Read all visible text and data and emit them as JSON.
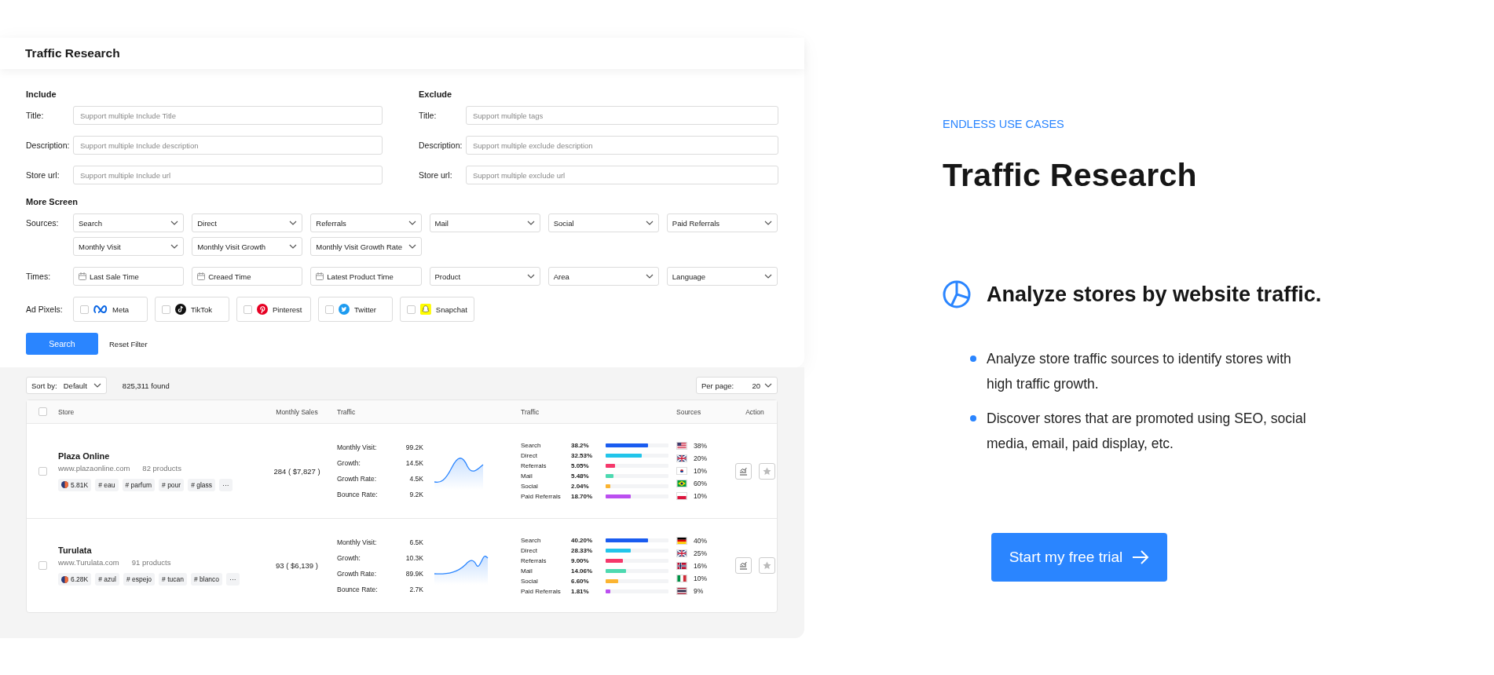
{
  "panel": {
    "title": "Traffic Research"
  },
  "include": {
    "heading": "Include",
    "fields": [
      {
        "label": "Title:",
        "placeholder": "Support multiple Include Title"
      },
      {
        "label": "Description:",
        "placeholder": "Support multiple Include description"
      },
      {
        "label": "Store url:",
        "placeholder": "Support multiple Include url"
      }
    ]
  },
  "exclude": {
    "heading": "Exclude",
    "fields": [
      {
        "label": "Title:",
        "placeholder": "Support multiple tags"
      },
      {
        "label": "Description:",
        "placeholder": "Support multiple exclude description"
      },
      {
        "label": "Store url:",
        "placeholder": "Support multiple exclude url"
      }
    ]
  },
  "more_screen": {
    "heading": "More Screen",
    "sources": {
      "label": "Sources:",
      "selects": [
        "Search",
        "Direct",
        "Referrals",
        "Mail",
        "Social",
        "Paid Referrals",
        "Monthly Visit",
        "Monthly Visit Growth",
        "Monthly Visit Growth Rate"
      ]
    },
    "times": {
      "label": "Times:",
      "fields": [
        {
          "kind": "date",
          "value": "Last Sale Time"
        },
        {
          "kind": "date",
          "value": "Creaed Time"
        },
        {
          "kind": "date",
          "value": "Latest Product Time"
        },
        {
          "kind": "select",
          "value": "Product"
        },
        {
          "kind": "select",
          "value": "Area"
        },
        {
          "kind": "select",
          "value": "Language"
        }
      ]
    },
    "ad_pixels": {
      "label": "Ad Pixels:",
      "items": [
        {
          "kind": "meta",
          "label": "Meta",
          "checked": false
        },
        {
          "kind": "tiktok",
          "label": "TikTok",
          "checked": false
        },
        {
          "kind": "pinterest",
          "label": "Pinterest",
          "checked": false
        },
        {
          "kind": "twitter",
          "label": "Twitter",
          "checked": false
        },
        {
          "kind": "snapchat",
          "label": "Snapchat",
          "checked": false
        }
      ]
    }
  },
  "actions": {
    "search": "Search",
    "reset": "Reset Filter"
  },
  "results": {
    "sort_label": "Sort by:",
    "sort_value": "Default",
    "found": "825,311 found",
    "per_page_label": "Per page:",
    "per_page_value": "20"
  },
  "table": {
    "select_all_checked": false,
    "columns": [
      "Store",
      "Monthly Sales",
      "Traffic",
      "Traffic",
      "Sources",
      "Action"
    ],
    "rows": [
      {
        "checked": false,
        "name": "Plaza Online",
        "url": "www.plazaonline.com",
        "products": "82 products",
        "traffic_badge": "5.81K",
        "tags": [
          "# eau",
          "# parfum",
          "# pour",
          "# glass"
        ],
        "more": "···",
        "sales": "284 ( $7,827 )",
        "metrics": [
          {
            "label": "Monthly Visit:",
            "value": "99.2K"
          },
          {
            "label": "Growth:",
            "value": "14.5K"
          },
          {
            "label": "Growth Rate:",
            "value": "4.5K"
          },
          {
            "label": "Bounce Rate:",
            "value": "9.2K"
          }
        ],
        "channels": [
          {
            "name": "Search",
            "share": "38.2%",
            "level": 0.67,
            "color": "#1a5cf0"
          },
          {
            "name": "Direct",
            "share": "32.53%",
            "level": 0.57,
            "color": "#22c5ea"
          },
          {
            "name": "Referrals",
            "share": "5.05%",
            "level": 0.15,
            "color": "#f5386b"
          },
          {
            "name": "Mail",
            "share": "5.48%",
            "level": 0.12,
            "color": "#4dd9b0"
          },
          {
            "name": "Social",
            "share": "2.04%",
            "level": 0.08,
            "color": "#fbb431"
          },
          {
            "name": "Paid Referrals",
            "share": "18.70%",
            "level": 0.4,
            "color": "#bb4ff0"
          }
        ],
        "countries": [
          {
            "kind": "us",
            "share": "38%"
          },
          {
            "kind": "gb",
            "share": "20%"
          },
          {
            "kind": "kr",
            "share": "10%"
          },
          {
            "kind": "br",
            "share": "60%"
          },
          {
            "kind": "pl",
            "share": "10%"
          }
        ]
      },
      {
        "checked": false,
        "name": "Turulata",
        "url": "www.Turulata.com",
        "products": "91 products",
        "traffic_badge": "6.28K",
        "tags": [
          "# azul",
          "# espejo",
          "# tucan",
          "# blanco"
        ],
        "more": "···",
        "sales": "93 ( $6,139 )",
        "metrics": [
          {
            "label": "Monthly Visit:",
            "value": "6.5K"
          },
          {
            "label": "Growth:",
            "value": "10.3K"
          },
          {
            "label": "Growth Rate:",
            "value": "89.9K"
          },
          {
            "label": "Bounce Rate:",
            "value": "2.7K"
          }
        ],
        "channels": [
          {
            "name": "Search",
            "share": "40.20%",
            "level": 0.67,
            "color": "#1a5cf0"
          },
          {
            "name": "Direct",
            "share": "28.33%",
            "level": 0.4,
            "color": "#22c5ea"
          },
          {
            "name": "Referrals",
            "share": "9.00%",
            "level": 0.27,
            "color": "#f5386b"
          },
          {
            "name": "Mail",
            "share": "14.06%",
            "level": 0.32,
            "color": "#4dd9b0"
          },
          {
            "name": "Social",
            "share": "6.60%",
            "level": 0.2,
            "color": "#fbb431"
          },
          {
            "name": "Paid Referrals",
            "share": "1.81%",
            "level": 0.08,
            "color": "#bb4ff0"
          }
        ],
        "countries": [
          {
            "kind": "de",
            "share": "40%"
          },
          {
            "kind": "gb",
            "share": "25%"
          },
          {
            "kind": "no",
            "share": "16%"
          },
          {
            "kind": "it",
            "share": "10%"
          },
          {
            "kind": "th",
            "share": "9%"
          }
        ]
      }
    ]
  },
  "promo": {
    "eyebrow": "ENDLESS USE CASES",
    "title": "Traffic Research",
    "feature": "Analyze stores by website traffic.",
    "bullets": [
      "Analyze store traffic sources to identify stores with high traffic growth.",
      "Discover stores that are promoted using SEO, social media, email, paid display, etc."
    ],
    "cta": "Start my free trial"
  }
}
